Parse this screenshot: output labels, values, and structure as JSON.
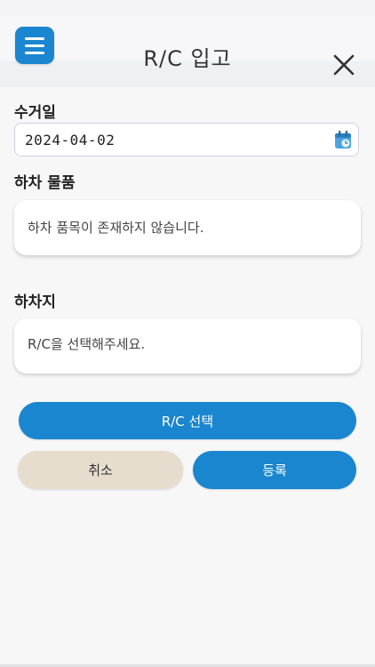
{
  "header": {
    "title": "R/C 입고",
    "menu_icon": "hamburger-menu-icon",
    "close_icon": "close-icon"
  },
  "pickup_date": {
    "label": "수거일",
    "value": "2024-04-02",
    "icon": "calendar-icon"
  },
  "unload_items": {
    "label": "하차 물품",
    "empty_message": "하차 품목이 존재하지 않습니다."
  },
  "unload_location": {
    "label": "하차지",
    "placeholder_message": "R/C을 선택해주세요."
  },
  "actions": {
    "select_rc_label": "R/C 선택",
    "cancel_label": "취소",
    "register_label": "등록"
  },
  "colors": {
    "primary": "#1a86cf",
    "cancel": "#e6ddce",
    "background": "#f7f7f8"
  }
}
